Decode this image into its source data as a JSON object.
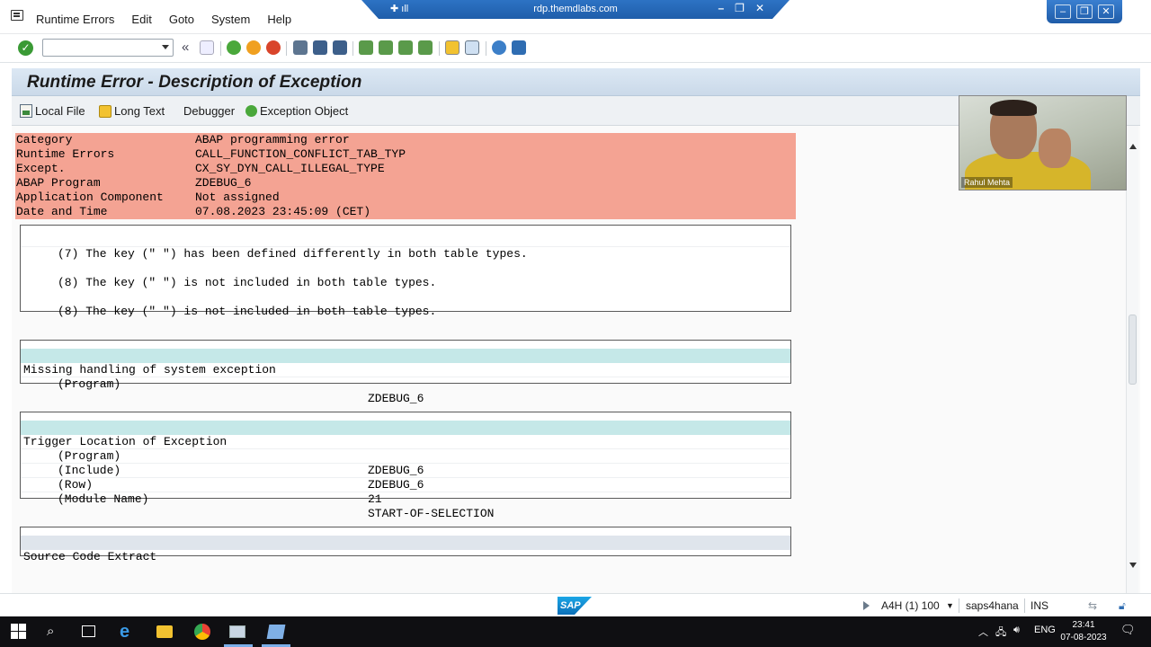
{
  "menubar": {
    "items": [
      "Runtime Errors",
      "Edit",
      "Goto",
      "System",
      "Help"
    ]
  },
  "rdp": {
    "title": "rdp.themdlabs.com"
  },
  "page": {
    "title": "Runtime Error - Description of Exception"
  },
  "app_toolbar": {
    "local_file": "Local File",
    "long_text": "Long Text",
    "debugger": "Debugger",
    "exception_object": "Exception Object"
  },
  "header_rows": [
    {
      "label": "Category",
      "value": "ABAP programming error"
    },
    {
      "label": "Runtime Errors",
      "value": "CALL_FUNCTION_CONFLICT_TAB_TYP"
    },
    {
      "label": "Except.",
      "value": "CX_SY_DYN_CALL_ILLEGAL_TYPE"
    },
    {
      "label": "ABAP Program",
      "value": "ZDEBUG_6"
    },
    {
      "label": "Application Component",
      "value": "Not assigned"
    },
    {
      "label": "Date and Time",
      "value": "07.08.2023 23:45:09 (CET)"
    }
  ],
  "key_lines": [
    "(7) The key (\" \") has been defined differently in both table types.",
    "(8) The key (\" \") is not included in both table types.",
    "(8) The key (\" \") is not included in both table types."
  ],
  "missing_handling": {
    "title": "Missing handling of system exception",
    "rows": [
      {
        "label": "(Program)",
        "value": "ZDEBUG_6"
      }
    ]
  },
  "trigger_location": {
    "title": "Trigger Location of Exception",
    "rows": [
      {
        "label": "(Program)",
        "value": "ZDEBUG_6"
      },
      {
        "label": "(Include)",
        "value": "ZDEBUG_6"
      },
      {
        "label": "(Row)",
        "value": "21"
      },
      {
        "label": "(Module Name)",
        "value": "START-OF-SELECTION"
      }
    ]
  },
  "source_extract": {
    "title": "Source Code Extract"
  },
  "webcam": {
    "name": "Rahul Mehta"
  },
  "statusbar": {
    "logo": "SAP",
    "system": "A4H (1) 100",
    "server": "saps4hana",
    "mode": "INS"
  },
  "taskbar": {
    "language": "ENG",
    "time": "23:41",
    "date": "07-08-2023"
  },
  "colors": {
    "header_highlight": "#f4a393",
    "section_band": "#c5e8e8",
    "title_band": "#dce8f4",
    "sap_blue": "#0b6fb8"
  }
}
